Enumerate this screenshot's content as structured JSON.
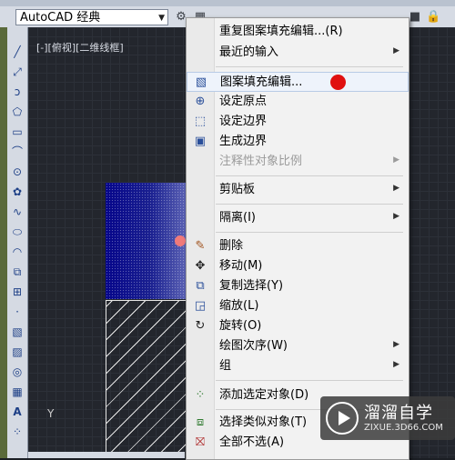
{
  "toolbar": {
    "workspace": "AutoCAD 经典",
    "icons": [
      "gear-icon",
      "workspace-icon",
      "layer-icon",
      "bulb-icon",
      "sun-icon",
      "lock-icon",
      "square-icon"
    ]
  },
  "viewport": {
    "label": "[-][俯视][二维线框]",
    "axis_label": "Y"
  },
  "left_tools": [
    "line",
    "construction-line",
    "polyline",
    "polygon",
    "rectangle",
    "arc",
    "circle",
    "revcloud",
    "spline",
    "ellipse",
    "ellipse-arc",
    "insert-block",
    "make-block",
    "point",
    "hatch",
    "gradient",
    "region",
    "table",
    "multiline-text",
    "add-selected"
  ],
  "menu": {
    "items": [
      {
        "label": "重复图案填充编辑...(R)",
        "icon": "",
        "submenu": false,
        "disabled": false
      },
      {
        "label": "最近的输入",
        "icon": "",
        "submenu": true,
        "disabled": false
      },
      {
        "label": "图案填充编辑...",
        "icon": "hatch-edit-icon",
        "submenu": false,
        "disabled": false
      },
      {
        "label": "设定原点",
        "icon": "set-origin-icon",
        "submenu": false,
        "disabled": false
      },
      {
        "label": "设定边界",
        "icon": "set-boundary-icon",
        "submenu": false,
        "disabled": false
      },
      {
        "label": "生成边界",
        "icon": "generate-boundary-icon",
        "submenu": false,
        "disabled": false
      },
      {
        "label": "注释性对象比例",
        "icon": "",
        "submenu": true,
        "disabled": true
      },
      {
        "label": "剪贴板",
        "icon": "",
        "submenu": true,
        "disabled": false
      },
      {
        "label": "隔离(I)",
        "icon": "",
        "submenu": true,
        "disabled": false
      },
      {
        "label": "删除",
        "icon": "erase-icon",
        "submenu": false,
        "disabled": false
      },
      {
        "label": "移动(M)",
        "icon": "move-icon",
        "submenu": false,
        "disabled": false
      },
      {
        "label": "复制选择(Y)",
        "icon": "copy-icon",
        "submenu": false,
        "disabled": false
      },
      {
        "label": "缩放(L)",
        "icon": "scale-icon",
        "submenu": false,
        "disabled": false
      },
      {
        "label": "旋转(O)",
        "icon": "rotate-icon",
        "submenu": false,
        "disabled": false
      },
      {
        "label": "绘图次序(W)",
        "icon": "",
        "submenu": true,
        "disabled": false
      },
      {
        "label": "组",
        "icon": "",
        "submenu": true,
        "disabled": false
      },
      {
        "label": "添加选定对象(D)",
        "icon": "add-selected-icon",
        "submenu": false,
        "disabled": false
      },
      {
        "label": "选择类似对象(T)",
        "icon": "select-similar-icon",
        "submenu": false,
        "disabled": false
      },
      {
        "label": "全部不选(A)",
        "icon": "deselect-all-icon",
        "submenu": false,
        "disabled": false
      }
    ]
  },
  "watermark": {
    "title": "溜溜自学",
    "subtitle": "ZIXUE.3D66.COM"
  }
}
